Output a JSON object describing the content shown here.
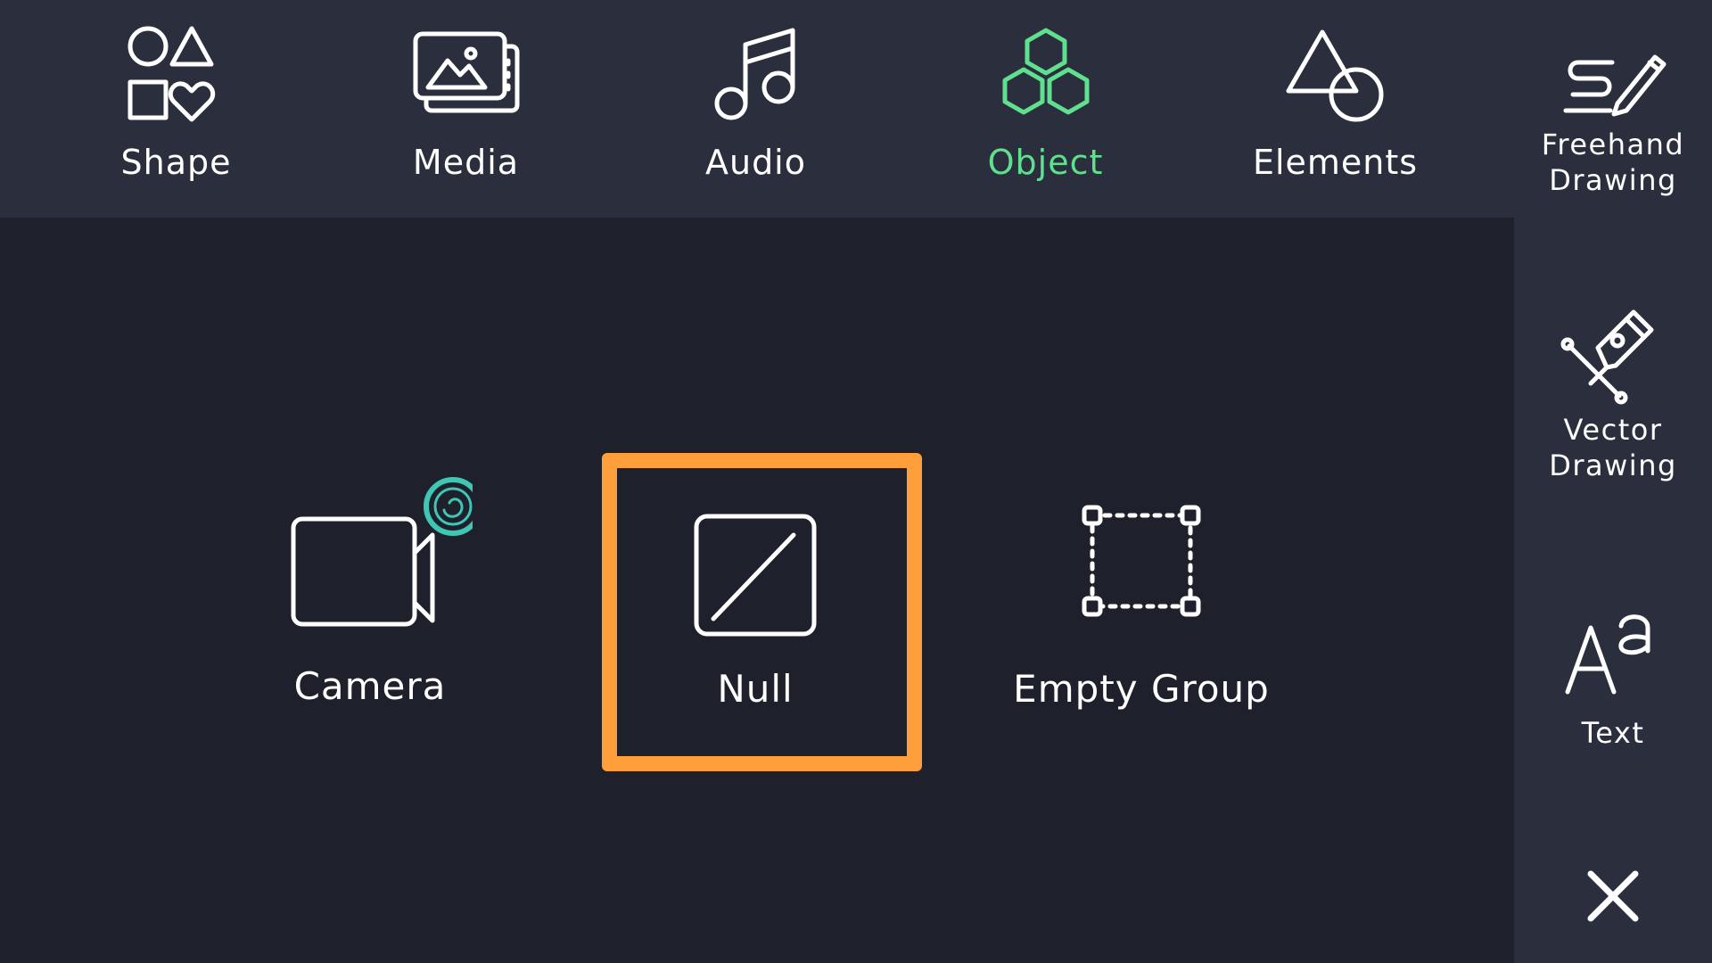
{
  "toolbar": {
    "items": [
      {
        "label": "Shape",
        "icon": "shapes-icon"
      },
      {
        "label": "Media",
        "icon": "media-icon"
      },
      {
        "label": "Audio",
        "icon": "music-note-icon"
      },
      {
        "label": "Object",
        "icon": "hexagons-icon",
        "active": true
      },
      {
        "label": "Elements",
        "icon": "triangle-circle-icon"
      }
    ]
  },
  "sidebar": {
    "freehand_label": "Freehand\nDrawing",
    "vector_label": "Vector\nDrawing",
    "text_label": "Text",
    "close_icon": "close-icon"
  },
  "objects": {
    "camera_label": "Camera",
    "null_label": "Null",
    "empty_group_label": "Empty Group"
  },
  "colors": {
    "background": "#1e202c",
    "bar": "#2b2e3c",
    "accent": "#5ee08e",
    "highlight": "#ff9f3b",
    "camera_badge": "#3fc6b4"
  }
}
